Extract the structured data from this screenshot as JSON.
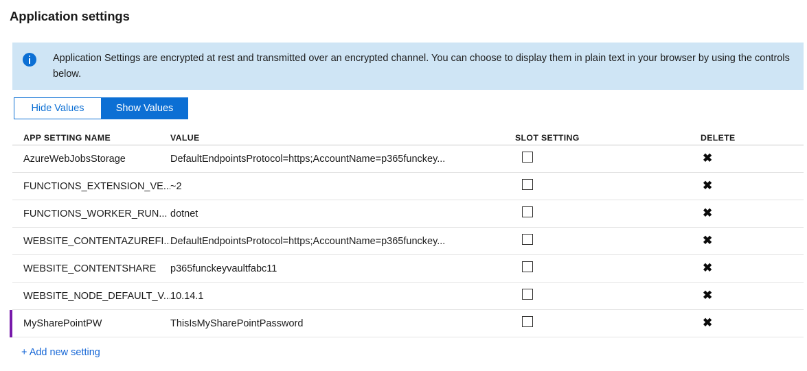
{
  "page": {
    "title": "Application settings"
  },
  "banner": {
    "icon": "info-circle-icon",
    "message": "Application Settings are encrypted at rest and transmitted over an encrypted channel. You can choose to display them in plain text in your browser by using the controls below."
  },
  "toggle": {
    "hide_label": "Hide Values",
    "show_label": "Show Values",
    "active": "Show Values"
  },
  "table": {
    "headers": {
      "name": "APP SETTING NAME",
      "value": "VALUE",
      "slot": "SLOT SETTING",
      "delete": "DELETE"
    },
    "delete_glyph": "✖",
    "rows": [
      {
        "name": "AzureWebJobsStorage",
        "value": "DefaultEndpointsProtocol=https;AccountName=p365funckey...",
        "slot_setting": false,
        "selected": false
      },
      {
        "name": "FUNCTIONS_EXTENSION_VE...",
        "value": "~2",
        "slot_setting": false,
        "selected": false
      },
      {
        "name": "FUNCTIONS_WORKER_RUN...",
        "value": "dotnet",
        "slot_setting": false,
        "selected": false
      },
      {
        "name": "WEBSITE_CONTENTAZUREFI...",
        "value": "DefaultEndpointsProtocol=https;AccountName=p365funckey...",
        "slot_setting": false,
        "selected": false
      },
      {
        "name": "WEBSITE_CONTENTSHARE",
        "value": "p365funckeyvaultfabc11",
        "slot_setting": false,
        "selected": false
      },
      {
        "name": "WEBSITE_NODE_DEFAULT_V...",
        "value": "10.14.1",
        "slot_setting": false,
        "selected": false
      },
      {
        "name": "MySharePointPW",
        "value": "ThisIsMySharePointPassword",
        "slot_setting": false,
        "selected": true
      }
    ]
  },
  "footer": {
    "add_label": "+ Add new setting"
  },
  "colors": {
    "accent_blue": "#0c6fd4",
    "banner_bg": "#cfe5f5",
    "link_blue": "#1566d6",
    "selected_bar": "#7719aa"
  }
}
